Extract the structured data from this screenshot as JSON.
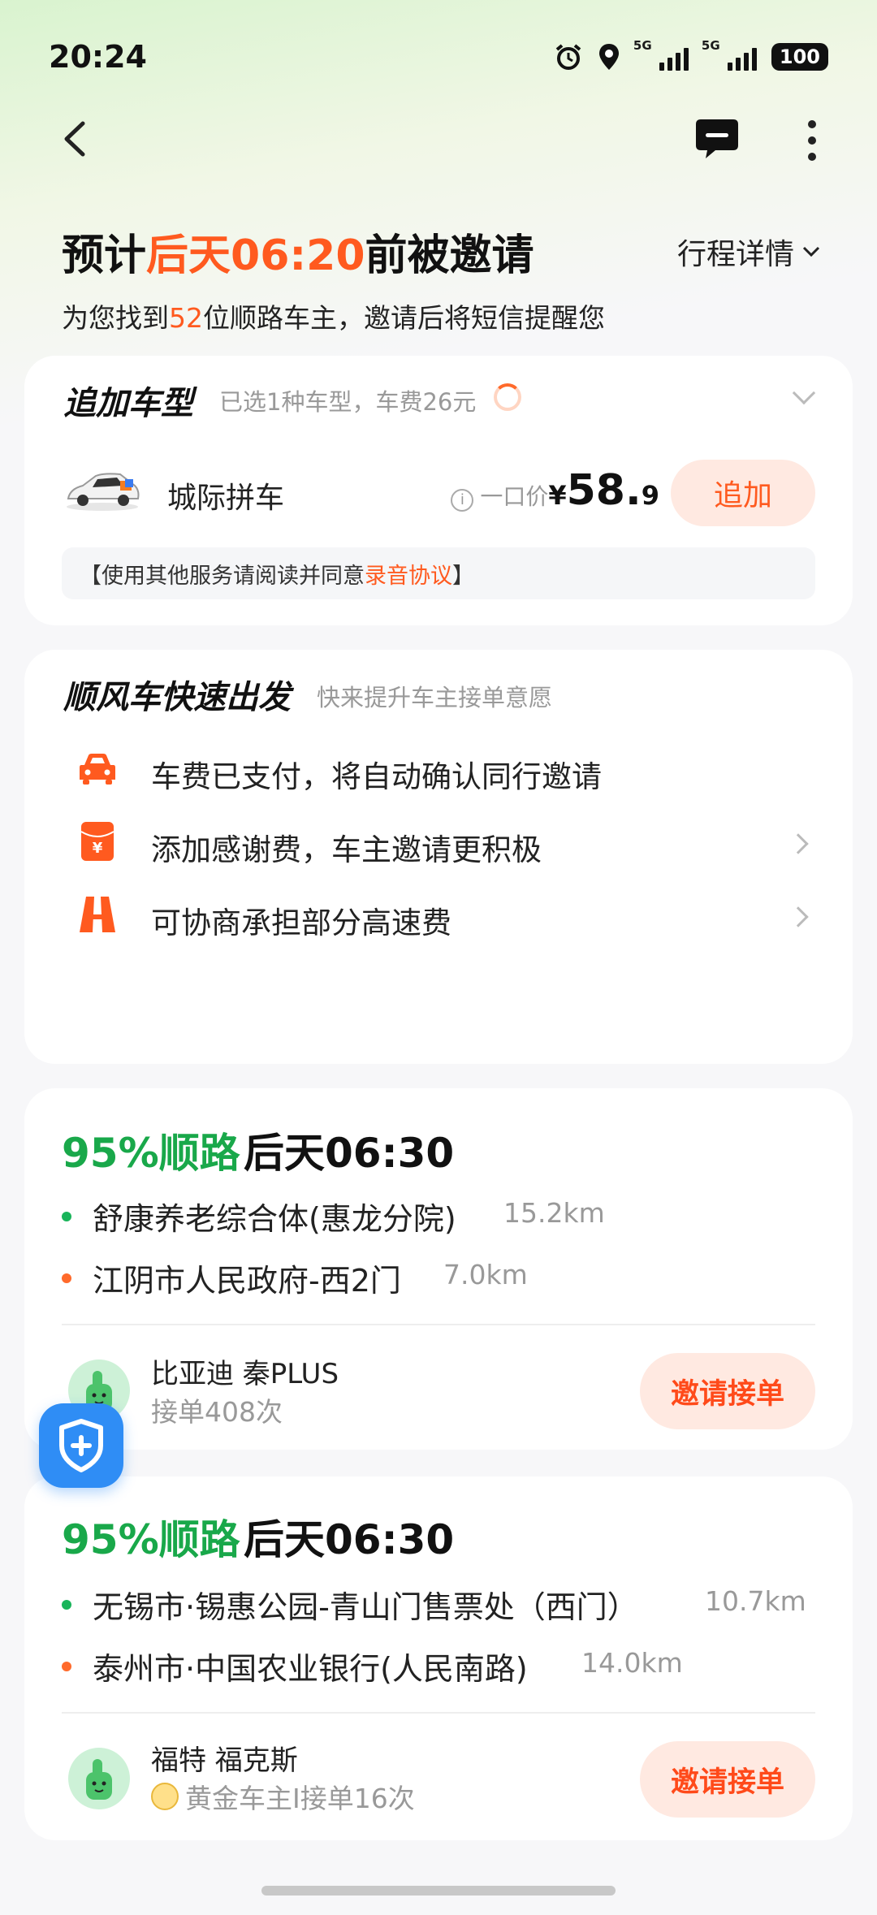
{
  "status": {
    "time": "20:24",
    "sim1": "5G",
    "sim2": "5G",
    "battery": "100"
  },
  "header": {
    "headline_prefix": "预计",
    "headline_highlight": "后天06:20",
    "headline_suffix": "前被邀请",
    "trip_detail": "行程详情",
    "sub_prefix": "为您找到",
    "sub_count": "52",
    "sub_suffix": "位顺路车主，邀请后将短信提醒您"
  },
  "add_car": {
    "title": "追加车型",
    "subtitle": "已选1种车型，车费26元",
    "car_name": "城际拼车",
    "price_label": "一口价",
    "currency": "¥",
    "price_int": "58.",
    "price_dec": "9",
    "add_label": "追加",
    "notice_prefix": "【使用其他服务请阅读并同意",
    "notice_link": "录音协议",
    "notice_suffix": "】"
  },
  "quick": {
    "title": "顺风车快速出发",
    "subtitle": "快来提升车主接单意愿",
    "items": [
      {
        "label": "车费已支付，将自动确认同行邀请",
        "icon": "car-icon"
      },
      {
        "label": "添加感谢费，车主邀请更积极",
        "icon": "red-envelope-icon"
      },
      {
        "label": "可协商承担部分高速费",
        "icon": "highway-icon"
      }
    ]
  },
  "drivers": [
    {
      "match": "95%顺路",
      "time": "后天06:30",
      "from": "舒康养老综合体(惠龙分院)",
      "from_dist": "15.2km",
      "to": "江阴市人民政府-西2门",
      "to_dist": "7.0km",
      "car_model": "比亚迪 秦PLUS",
      "orders": "接单408次",
      "invite_label": "邀请接单"
    },
    {
      "match": "95%顺路",
      "time": "后天06:30",
      "from": "无锡市·锡惠公园-青山门售票处（西门）",
      "from_dist": "10.7km",
      "to": "泰州市·中国农业银行(人民南路)",
      "to_dist": "14.0km",
      "car_model": "福特 福克斯",
      "orders": "黄金车主I接单16次",
      "invite_label": "邀请接单"
    }
  ],
  "colors": {
    "accent": "#ff5a1f",
    "match_green": "#19a84a",
    "safety_blue": "#2f8df5"
  }
}
